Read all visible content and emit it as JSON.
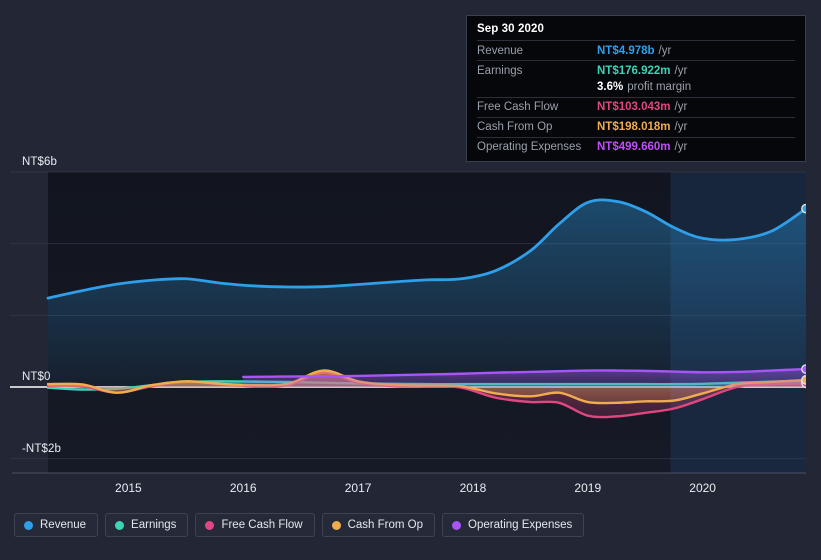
{
  "chart_data": {
    "type": "area",
    "title": "",
    "xlabel": "",
    "ylabel": "",
    "ylim": [
      -2,
      6
    ],
    "y_unit": "NT$",
    "grid": true,
    "legend_position": "bottom",
    "y_ticks": [
      {
        "label": "NT$6b",
        "value": 6
      },
      {
        "label": "NT$0",
        "value": 0
      },
      {
        "label": "-NT$2b",
        "value": -2
      }
    ],
    "x_ticks": [
      "2015",
      "2016",
      "2017",
      "2018",
      "2019",
      "2020"
    ],
    "x_range": [
      "2014.3",
      "2020.9"
    ],
    "series": [
      {
        "name": "Revenue",
        "color": "#2e9fe8",
        "x": [
          2014.3,
          2014.6,
          2014.9,
          2015.2,
          2015.5,
          2015.8,
          2016.1,
          2016.4,
          2016.7,
          2017.0,
          2017.3,
          2017.6,
          2017.9,
          2018.2,
          2018.5,
          2018.75,
          2019.0,
          2019.25,
          2019.5,
          2019.75,
          2020.0,
          2020.3,
          2020.6,
          2020.9
        ],
        "values": [
          2.48,
          2.69,
          2.87,
          2.98,
          3.02,
          2.9,
          2.82,
          2.79,
          2.8,
          2.86,
          2.93,
          2.99,
          3.02,
          3.25,
          3.8,
          4.55,
          5.15,
          5.18,
          4.9,
          4.45,
          4.15,
          4.12,
          4.35,
          4.978
        ]
      },
      {
        "name": "Earnings",
        "color": "#3bd4b4",
        "x": [
          2014.3,
          2014.6,
          2014.9,
          2015.2,
          2015.5,
          2015.8,
          2016.1,
          2016.4,
          2016.7,
          2017.0,
          2017.3,
          2017.6,
          2017.9,
          2018.2,
          2018.5,
          2018.75,
          2019.0,
          2019.25,
          2019.5,
          2019.75,
          2020.0,
          2020.3,
          2020.6,
          2020.9
        ],
        "values": [
          -0.02,
          -0.07,
          -0.05,
          0.05,
          0.14,
          0.16,
          0.15,
          0.14,
          0.12,
          0.1,
          0.09,
          0.08,
          0.08,
          0.08,
          0.08,
          0.08,
          0.08,
          0.08,
          0.08,
          0.08,
          0.09,
          0.12,
          0.15,
          0.176922
        ]
      },
      {
        "name": "Free Cash Flow",
        "color": "#e0467f",
        "x": [
          2014.3,
          2014.6,
          2014.9,
          2015.2,
          2015.5,
          2015.8,
          2016.1,
          2016.4,
          2016.7,
          2017.0,
          2017.3,
          2017.6,
          2017.9,
          2018.2,
          2018.5,
          2018.75,
          2019.0,
          2019.25,
          2019.5,
          2019.75,
          2020.0,
          2020.3,
          2020.6,
          2020.9
        ],
        "values": [
          0.03,
          0.02,
          -0.16,
          0.02,
          0.14,
          0.08,
          0.02,
          0.06,
          0.4,
          0.12,
          0.03,
          0.02,
          -0.02,
          -0.3,
          -0.42,
          -0.44,
          -0.8,
          -0.82,
          -0.72,
          -0.6,
          -0.34,
          0.0,
          0.08,
          0.103043
        ]
      },
      {
        "name": "Cash From Op",
        "color": "#eead4e",
        "x": [
          2014.3,
          2014.6,
          2014.9,
          2015.2,
          2015.5,
          2015.8,
          2016.1,
          2016.4,
          2016.7,
          2017.0,
          2017.3,
          2017.6,
          2017.9,
          2018.2,
          2018.5,
          2018.75,
          2019.0,
          2019.25,
          2019.5,
          2019.75,
          2020.0,
          2020.3,
          2020.6,
          2020.9
        ],
        "values": [
          0.08,
          0.07,
          -0.16,
          0.05,
          0.16,
          0.09,
          0.05,
          0.1,
          0.46,
          0.16,
          0.06,
          0.04,
          0.02,
          -0.18,
          -0.26,
          -0.16,
          -0.42,
          -0.44,
          -0.4,
          -0.38,
          -0.18,
          0.08,
          0.14,
          0.198018
        ]
      },
      {
        "name": "Operating Expenses",
        "color": "#a855f7",
        "x": [
          2016.0,
          2016.3,
          2016.7,
          2017.0,
          2017.3,
          2017.6,
          2017.9,
          2018.2,
          2018.5,
          2018.75,
          2019.0,
          2019.25,
          2019.5,
          2019.75,
          2020.0,
          2020.3,
          2020.6,
          2020.9
        ],
        "values": [
          0.28,
          0.29,
          0.3,
          0.31,
          0.33,
          0.35,
          0.37,
          0.4,
          0.42,
          0.44,
          0.46,
          0.46,
          0.45,
          0.43,
          0.41,
          0.42,
          0.46,
          0.49966
        ]
      }
    ],
    "highlight_band": {
      "from": 2019.72,
      "to": 2020.9
    }
  },
  "tooltip": {
    "date": "Sep 30 2020",
    "rows": [
      {
        "label": "Revenue",
        "value": "NT$4.978b",
        "unit": "/yr",
        "color": "#2e9fe8"
      },
      {
        "label": "Earnings",
        "value": "NT$176.922m",
        "unit": "/yr",
        "color": "#3bd4b4"
      },
      {
        "label": "",
        "value": "3.6%",
        "unit": "profit margin",
        "color": "#ffffff",
        "margin": true
      },
      {
        "label": "Free Cash Flow",
        "value": "NT$103.043m",
        "unit": "/yr",
        "color": "#e0467f"
      },
      {
        "label": "Cash From Op",
        "value": "NT$198.018m",
        "unit": "/yr",
        "color": "#eead4e"
      },
      {
        "label": "Operating Expenses",
        "value": "NT$499.660m",
        "unit": "/yr",
        "color": "#c04df9"
      }
    ]
  },
  "legend": {
    "items": [
      {
        "label": "Revenue",
        "color": "#2e9fe8"
      },
      {
        "label": "Earnings",
        "color": "#3bd4b4"
      },
      {
        "label": "Free Cash Flow",
        "color": "#e0467f"
      },
      {
        "label": "Cash From Op",
        "color": "#eead4e"
      },
      {
        "label": "Operating Expenses",
        "color": "#a855f7"
      }
    ]
  }
}
